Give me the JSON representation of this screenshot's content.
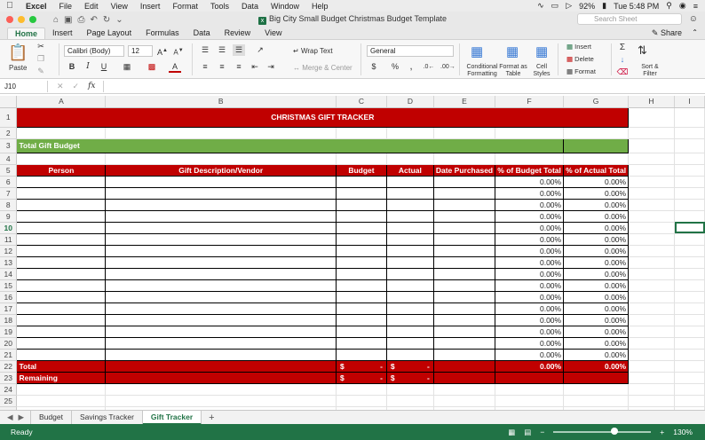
{
  "menubar": {
    "app": "Excel",
    "items": [
      "File",
      "Edit",
      "View",
      "Insert",
      "Format",
      "Tools",
      "Data",
      "Window",
      "Help"
    ],
    "battery": "92%",
    "clock": "Tue 5:48 PM"
  },
  "window": {
    "title": "Big City Small Budget Christmas Budget Template",
    "search_placeholder": "Search Sheet"
  },
  "ribbon": {
    "tabs": [
      "Home",
      "Insert",
      "Page Layout",
      "Formulas",
      "Data",
      "Review",
      "View"
    ],
    "active_tab": "Home",
    "share_label": "Share",
    "paste_label": "Paste",
    "font_name": "Calibri (Body)",
    "font_size": "12",
    "wrap_text": "Wrap Text",
    "merge_center": "Merge & Center",
    "number_format": "General",
    "conditional_formatting": "Conditional Formatting",
    "format_as_table": "Format as Table",
    "cell_styles": "Cell Styles",
    "insert": "Insert",
    "delete": "Delete",
    "format": "Format",
    "sort_filter": "Sort & Filter"
  },
  "formula_bar": {
    "name_box": "J10",
    "fx": "fx",
    "content": ""
  },
  "columns": [
    "A",
    "B",
    "C",
    "D",
    "E",
    "F",
    "G",
    "H",
    "I"
  ],
  "sheet": {
    "title": "CHRISTMAS GIFT TRACKER",
    "budget_label": "Total Gift Budget",
    "headers": [
      "Person",
      "Gift Description/Vendor",
      "Budget",
      "Actual",
      "Date Purchased",
      "% of Budget Total",
      "% of Actual Total"
    ],
    "data_rows": [
      6,
      7,
      8,
      9,
      10,
      11,
      12,
      13,
      14,
      15,
      16,
      17,
      18,
      19,
      20,
      21
    ],
    "pct_value": "0.00%",
    "total_label": "Total",
    "remaining_label": "Remaining",
    "currency_symbol": "$",
    "dash": "-",
    "selected_row": 10
  },
  "sheet_tabs": [
    "Budget",
    "Savings Tracker",
    "Gift Tracker"
  ],
  "active_sheet": "Gift Tracker",
  "status": {
    "ready": "Ready",
    "zoom": "130%",
    "zoom_fraction": 0.63
  },
  "colors": {
    "red": "#c00000",
    "green": "#70ad47",
    "excel_green": "#217346"
  }
}
